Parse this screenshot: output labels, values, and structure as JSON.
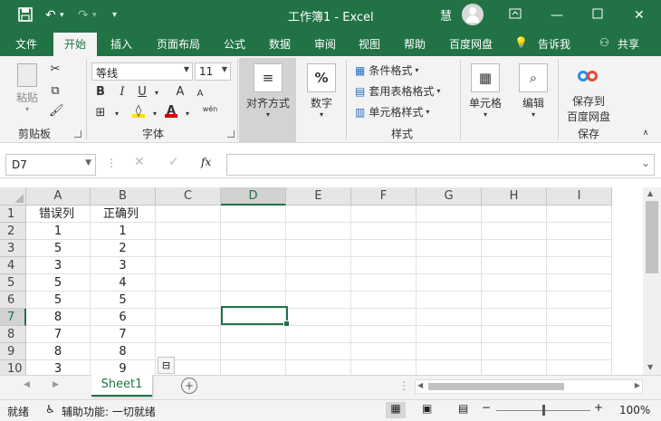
{
  "titlebar": {
    "title": "工作簿1  -  Excel",
    "user_initial": "慧",
    "icons": [
      "save-icon",
      "undo-icon",
      "redo-icon",
      "customize-qat-icon",
      "ribbon-display-icon",
      "minimize-icon",
      "restore-icon",
      "close-icon"
    ]
  },
  "menu": {
    "file": "文件",
    "home": "开始",
    "insert": "插入",
    "layout": "页面布局",
    "formulas": "公式",
    "data": "数据",
    "review": "审阅",
    "view": "视图",
    "help": "帮助",
    "baidu": "百度网盘",
    "tell": "告诉我",
    "share": "共享"
  },
  "ribbon": {
    "paste": "粘贴",
    "clipboard": "剪贴板",
    "font_name": "等线",
    "font_size": "11",
    "bold": "B",
    "italic": "I",
    "underline": "U",
    "grow": "A",
    "shrink": "A",
    "wen": "wén",
    "font_group": "字体",
    "alignment": "对齐方式",
    "number": "数字",
    "number_symbol": "%",
    "cond_format": "条件格式",
    "table_format": "套用表格格式",
    "cell_style": "单元格样式",
    "styles_group": "样式",
    "cells": "单元格",
    "editing": "编辑",
    "save_baidu_line1": "保存到",
    "save_baidu_line2": "百度网盘",
    "save_group": "保存"
  },
  "formula": {
    "namebox": "D7",
    "fx": "fx",
    "value": ""
  },
  "sheet": {
    "columns": [
      "A",
      "B",
      "C",
      "D",
      "E",
      "F",
      "G",
      "H",
      "I"
    ],
    "rows": [
      "1",
      "2",
      "3",
      "4",
      "5",
      "6",
      "7",
      "8",
      "9",
      "10"
    ],
    "data": [
      [
        "错误列",
        "正确列"
      ],
      [
        "1",
        "1"
      ],
      [
        "5",
        "2"
      ],
      [
        "3",
        "3"
      ],
      [
        "5",
        "4"
      ],
      [
        "5",
        "5"
      ],
      [
        "8",
        "6"
      ],
      [
        "7",
        "7"
      ],
      [
        "8",
        "8"
      ],
      [
        "3",
        "9"
      ]
    ],
    "selected_col": "D",
    "selected_row": "7"
  },
  "tabs": {
    "sheet1": "Sheet1",
    "add": "+"
  },
  "status": {
    "mode": "就绪",
    "accessibility": "辅助功能: 一切就绪",
    "zoom": "100%"
  },
  "colors": {
    "accent": "#217346"
  }
}
